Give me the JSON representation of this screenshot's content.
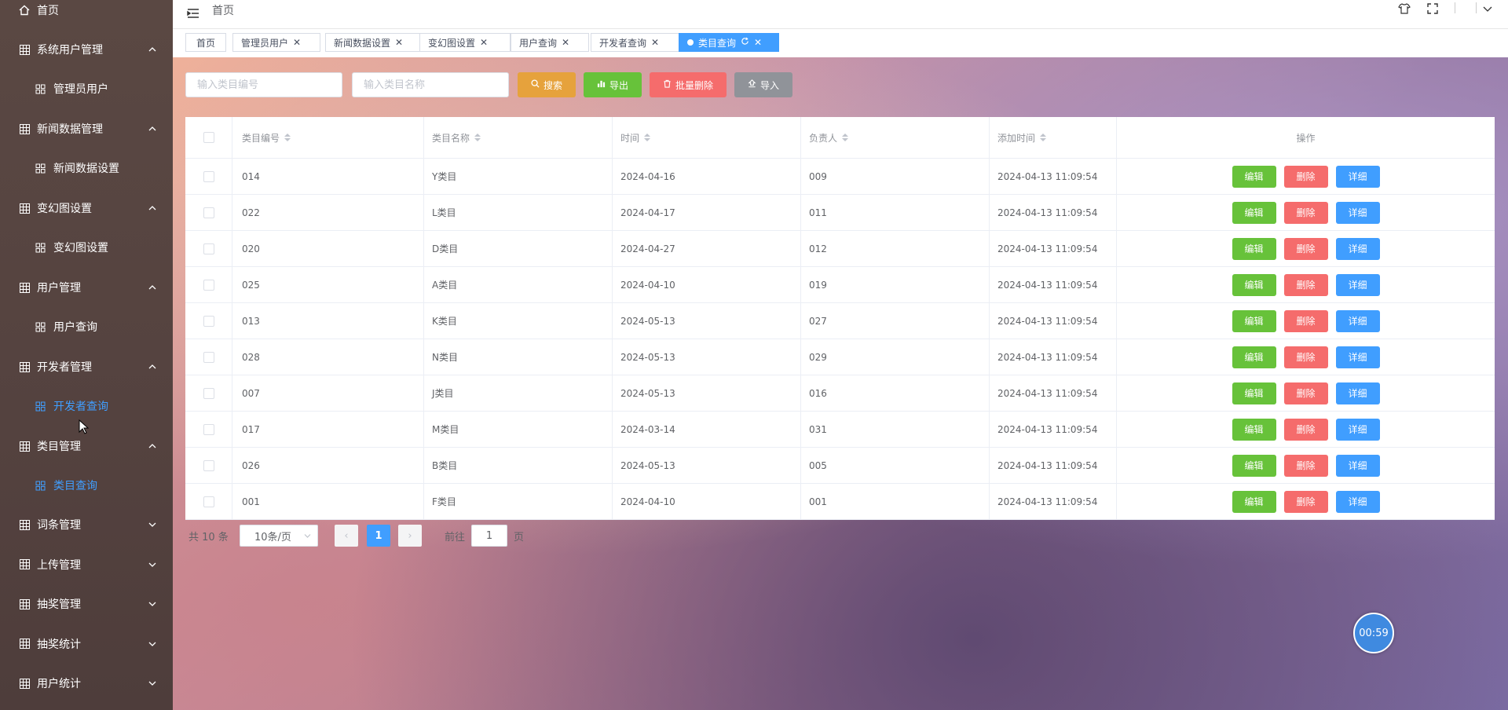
{
  "sidebar": {
    "home": "首页",
    "groups": [
      {
        "label": "系统用户管理",
        "sub": "管理员用户"
      },
      {
        "label": "新闻数据管理",
        "sub": "新闻数据设置"
      },
      {
        "label": "变幻图设置",
        "sub": "变幻图设置"
      },
      {
        "label": "用户管理",
        "sub": "用户查询"
      },
      {
        "label": "开发者管理",
        "sub": "开发者查询"
      },
      {
        "label": "类目管理",
        "sub": "类目查询"
      }
    ],
    "collapsed": [
      "词条管理",
      "上传管理",
      "抽奖管理",
      "抽奖统计",
      "用户统计"
    ]
  },
  "header": {
    "breadcrumb": "首页"
  },
  "tabs": [
    "首页",
    "管理员用户",
    "新闻数据设置",
    "变幻图设置",
    "用户查询",
    "开发者查询",
    "类目查询"
  ],
  "search": {
    "code_placeholder": "输入类目编号",
    "name_placeholder": "输入类目名称",
    "search_label": "搜索",
    "export_label": "导出",
    "batch_delete_label": "批量删除",
    "import_label": "导入"
  },
  "table": {
    "headers": {
      "code": "类目编号",
      "name": "类目名称",
      "time": "时间",
      "owner": "负责人",
      "added": "添加时间",
      "ops": "操作"
    },
    "actions": {
      "edit": "编辑",
      "delete": "删除",
      "detail": "详细"
    },
    "rows": [
      {
        "code": "014",
        "name": "Y类目",
        "time": "2024-04-16",
        "owner": "009",
        "added": "2024-04-13 11:09:54"
      },
      {
        "code": "022",
        "name": "L类目",
        "time": "2024-04-17",
        "owner": "011",
        "added": "2024-04-13 11:09:54"
      },
      {
        "code": "020",
        "name": "D类目",
        "time": "2024-04-27",
        "owner": "012",
        "added": "2024-04-13 11:09:54"
      },
      {
        "code": "025",
        "name": "A类目",
        "time": "2024-04-10",
        "owner": "019",
        "added": "2024-04-13 11:09:54"
      },
      {
        "code": "013",
        "name": "K类目",
        "time": "2024-05-13",
        "owner": "027",
        "added": "2024-04-13 11:09:54"
      },
      {
        "code": "028",
        "name": "N类目",
        "time": "2024-05-13",
        "owner": "029",
        "added": "2024-04-13 11:09:54"
      },
      {
        "code": "007",
        "name": "J类目",
        "time": "2024-05-13",
        "owner": "016",
        "added": "2024-04-13 11:09:54"
      },
      {
        "code": "017",
        "name": "M类目",
        "time": "2024-03-14",
        "owner": "031",
        "added": "2024-04-13 11:09:54"
      },
      {
        "code": "026",
        "name": "B类目",
        "time": "2024-05-13",
        "owner": "005",
        "added": "2024-04-13 11:09:54"
      },
      {
        "code": "001",
        "name": "F类目",
        "time": "2024-04-10",
        "owner": "001",
        "added": "2024-04-13 11:09:54"
      }
    ]
  },
  "pagination": {
    "total_text": "共 10 条",
    "page_size": "10条/页",
    "current_page": "1",
    "goto_prefix": "前往",
    "goto_value": "1",
    "goto_suffix": "页"
  },
  "timer": "00:59",
  "colors": {
    "primary": "#409eff",
    "success": "#67c23a",
    "danger": "#f56c6c",
    "warning": "#e6a23c",
    "info": "#909399"
  }
}
